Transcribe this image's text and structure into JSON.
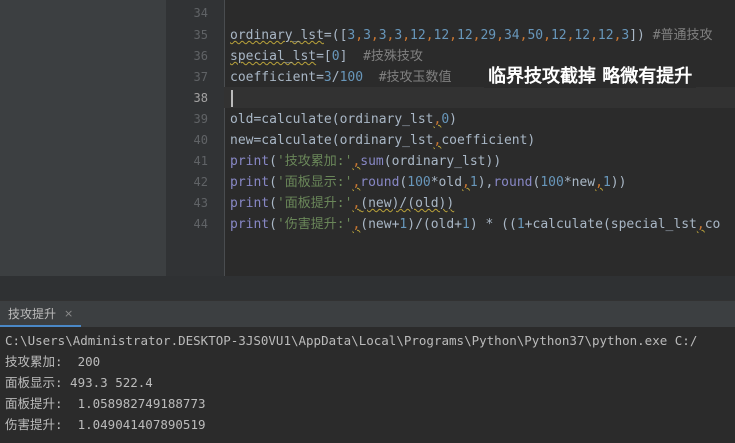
{
  "editor": {
    "line_numbers": [
      "34",
      "35",
      "36",
      "37",
      "38",
      "39",
      "40",
      "41",
      "42",
      "43",
      "44"
    ],
    "current_line": "38"
  },
  "code": {
    "l35": {
      "var": "ordinary_lst",
      "eq": "=([",
      "n1": "3",
      "n2": "3",
      "n3": "3",
      "n4": "3",
      "n5": "12",
      "n6": "12",
      "n7": "12",
      "n8": "29",
      "n9": "34",
      "n10": "50",
      "n11": "12",
      "n12": "12",
      "n13": "12",
      "n14": "3",
      "close": "])",
      "comment": "#普通技攻"
    },
    "l36": {
      "var": "special_lst",
      "eq": "=[",
      "n1": "0",
      "close": "]",
      "comment": "#技殊技攻"
    },
    "l37": {
      "var": "coefficient",
      "eq": "=",
      "n1": "3",
      "div": "/",
      "n2": "100",
      "comment": "#技攻玉数值"
    },
    "l39": {
      "text_a": "old=calculate(ordinary_lst",
      "comma": ",",
      "n1": "0",
      "text_b": ")"
    },
    "l40": {
      "text_a": "new=calculate(ordinary_lst",
      "comma": ",",
      "text_b": "coefficient)"
    },
    "l41": {
      "fn": "print",
      "open": "(",
      "str": "'技攻累加:'",
      "comma": ",",
      "fn2": "sum",
      "rest": "(ordinary_lst))"
    },
    "l42": {
      "fn": "print",
      "open": "(",
      "str": "'面板显示:'",
      "comma": ",",
      "fn2": "round",
      "a": "(",
      "n1": "100",
      "b": "*old",
      "n2": "1",
      "c": "),",
      "fn3": "round",
      "d": "(",
      "n3": "100",
      "e": "*new",
      "n4": "1",
      "f": "))"
    },
    "l43": {
      "fn": "print",
      "open": "(",
      "str": "'面板提升:'",
      "comma": ",",
      "rest": "(new)/(old))"
    },
    "l44": {
      "fn": "print",
      "open": "(",
      "str": "'伤害提升:'",
      "comma": ",",
      "a": "(new+",
      "n1": "1",
      "b": ")/(old+",
      "n2": "1",
      "c": ") * ((",
      "n3": "1",
      "d": "+calculate(special_lst",
      "e": "co"
    }
  },
  "overlay_caption": "临界技攻截掉 略微有提升",
  "run_panel": {
    "tab_label": "技攻提升",
    "close_symbol": "×",
    "command": "C:\\Users\\Administrator.DESKTOP-3JS0VU1\\AppData\\Local\\Programs\\Python\\Python37\\python.exe C:/",
    "output": [
      "技攻累加:  200",
      "面板显示: 493.3 522.4",
      "面板提升:  1.058982749188773",
      "伤害提升:  1.049041407890519"
    ]
  },
  "colors": {
    "keyword": "#cc7832",
    "number": "#6897bb",
    "string": "#6a8759",
    "comment": "#808080",
    "builtin": "#8888c6",
    "text": "#a9b7c6"
  }
}
